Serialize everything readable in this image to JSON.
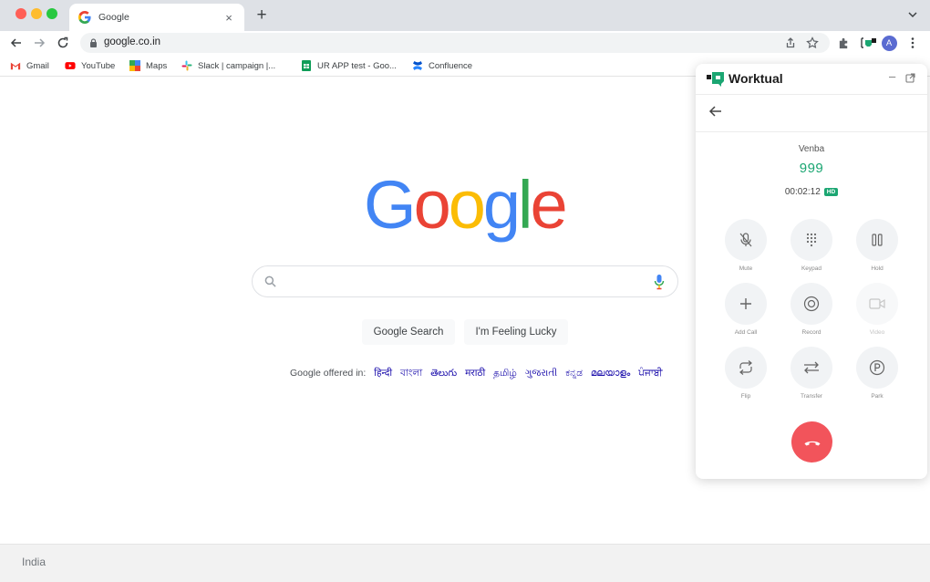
{
  "browser": {
    "tab_title": "Google",
    "tab_close": "×",
    "new_tab": "+",
    "url": "google.co.in",
    "profile_initial": "A",
    "bookmarks": [
      "Gmail",
      "YouTube",
      "Maps",
      "Slack | campaign |...",
      "UR APP test - Goo...",
      "Confluence"
    ]
  },
  "google": {
    "logo_letters": [
      "G",
      "o",
      "o",
      "g",
      "l",
      "e"
    ],
    "search_placeholder": "",
    "search_button": "Google Search",
    "lucky_button": "I'm Feeling Lucky",
    "offered_in_label": "Google offered in:",
    "languages": [
      "हिन्दी",
      "বাংলা",
      "తెలుగు",
      "मराठी",
      "தமிழ்",
      "ગુજરાતી",
      "ಕನ್ನಡ",
      "മലയാളം",
      "ਪੰਜਾਬੀ"
    ],
    "footer_country": "India"
  },
  "widget": {
    "brand": "Worktual",
    "minimize": "–",
    "caller_name": "Venba",
    "caller_number": "999",
    "call_timer": "00:02:12",
    "hd_badge": "HD",
    "controls": [
      "Mute",
      "Keypad",
      "Hold",
      "Add Call",
      "Record",
      "Video",
      "Flip",
      "Transfer",
      "Park"
    ],
    "accent_color": "#1ba672",
    "hangup_color": "#f2545b"
  }
}
